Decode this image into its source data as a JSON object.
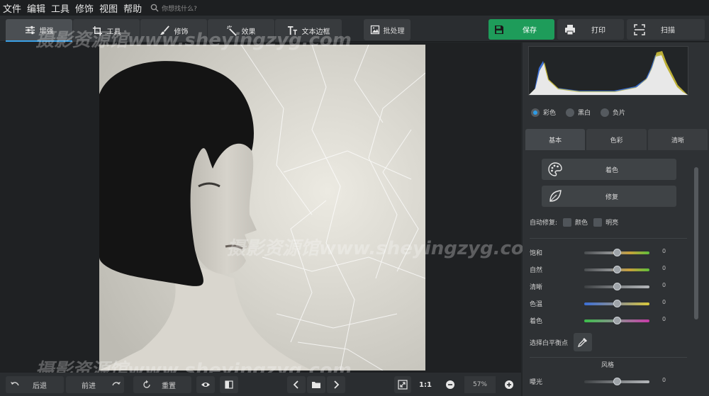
{
  "menu": [
    "文件",
    "编辑",
    "工具",
    "修饰",
    "视图",
    "帮助"
  ],
  "search": {
    "placeholder": "你想找什么?"
  },
  "tabs": [
    {
      "label": "增强",
      "icon": "sliders-icon"
    },
    {
      "label": "工具",
      "icon": "crop-icon"
    },
    {
      "label": "修饰",
      "icon": "brush-icon"
    },
    {
      "label": "效果",
      "icon": "magic-wand-icon"
    },
    {
      "label": "文本边框",
      "icon": "text-icon"
    }
  ],
  "toolbar": {
    "batch_label": "批处理",
    "save_label": "保存",
    "print_label": "打印",
    "scan_label": "扫描"
  },
  "watermark": {
    "site": "摄影资源馆www.sheyingzyg.com",
    "site_short": "摄影资源馆www.sheyingzyg.com"
  },
  "bottombar": {
    "undo_label": "后退",
    "redo_label": "前进",
    "reset_label": "重置",
    "one_to_one": "1:1",
    "zoom": "57%"
  },
  "panel": {
    "modes": [
      {
        "label": "彩色",
        "selected": true
      },
      {
        "label": "黑白",
        "selected": false
      },
      {
        "label": "负片",
        "selected": false
      }
    ],
    "tabs": [
      {
        "label": "基本",
        "active": true
      },
      {
        "label": "色彩",
        "active": false
      },
      {
        "label": "清晰",
        "active": false
      }
    ],
    "colorize_label": "着色",
    "repair_label": "修复",
    "autofix_label": "自动修复:",
    "autofix_color": "颜色",
    "autofix_bright": "明亮",
    "sliders": [
      {
        "label": "饱和",
        "value": "0",
        "gradient": "linear-gradient(90deg,#4a4d50,#8d8f91 40%,#c8a03a 70%,#5fbf3a)"
      },
      {
        "label": "自然",
        "value": "0",
        "gradient": "linear-gradient(90deg,#4a4d50,#8d8f91 40%,#c8a03a 70%,#5fbf3a)"
      },
      {
        "label": "清晰",
        "value": "0",
        "gradient": "linear-gradient(90deg,#3d4043,#7d8083 50%,#b4b7ba)"
      },
      {
        "label": "色温",
        "value": "0",
        "gradient": "linear-gradient(90deg,#3b6fd6,#8d8f91 50%,#d8c83a)"
      },
      {
        "label": "着色",
        "value": "0",
        "gradient": "linear-gradient(90deg,#3bbf4a,#8d8f91 50%,#c83aa8)"
      }
    ],
    "whitepoint_label": "选择白平衡点",
    "style_header": "风格",
    "exposure": {
      "label": "曝光",
      "value": "0"
    }
  },
  "colors": {
    "accent": "#2d9be5",
    "save": "#1e9c5a"
  }
}
